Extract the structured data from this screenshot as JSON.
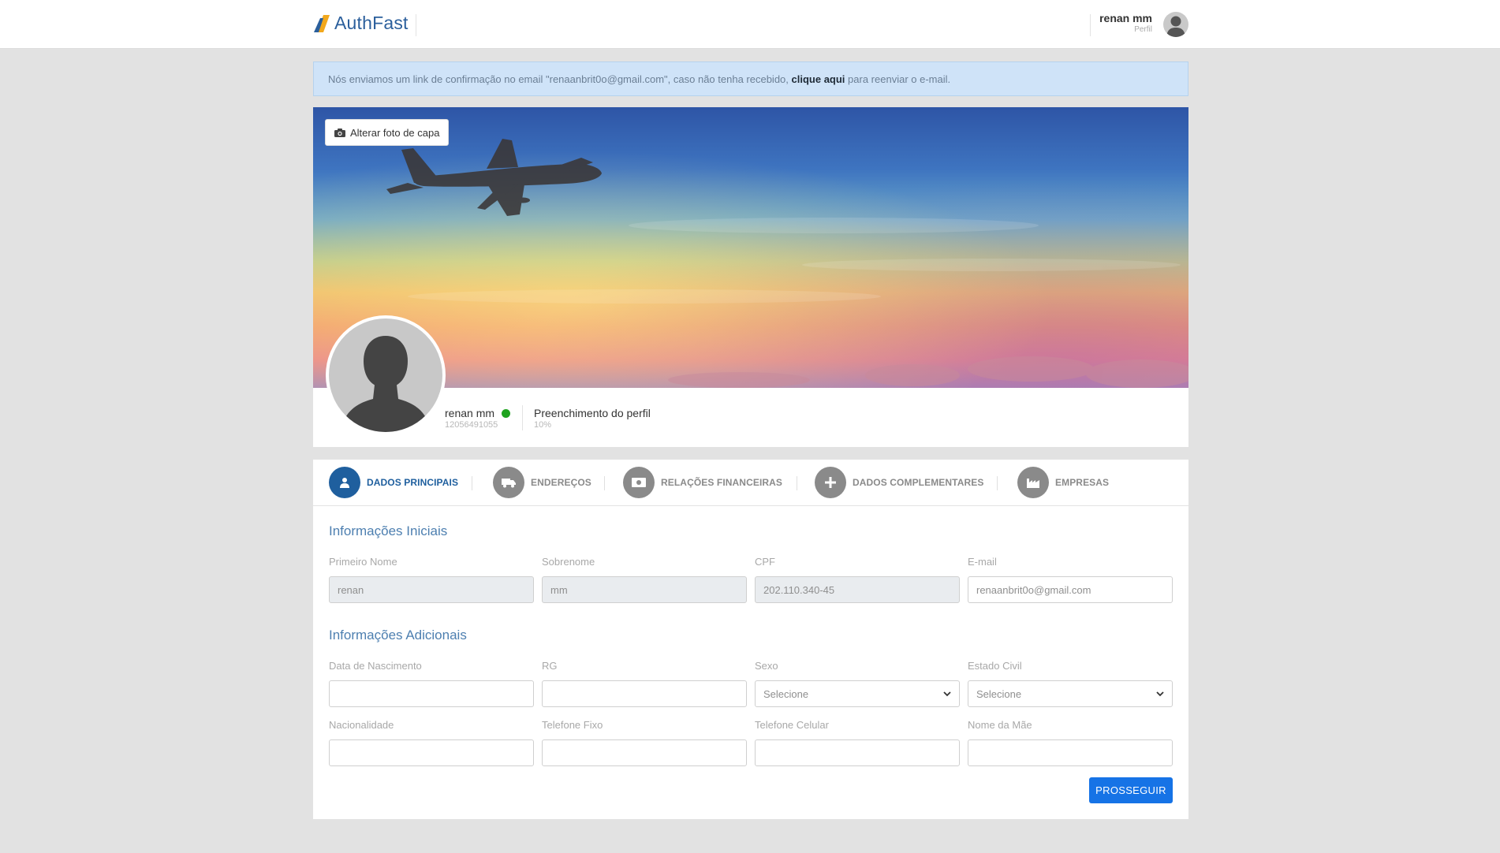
{
  "app": {
    "name": "AuthFast"
  },
  "header": {
    "user_name": "renan mm",
    "user_sub": "Perfil"
  },
  "alert": {
    "pre": "Nós enviamos um link de confirmação no email \"renaanbrit0o@gmail.com\", caso não tenha recebido,",
    "link": "clique aqui",
    "post": "para reenviar o e-mail."
  },
  "cover": {
    "change_label": "Alterar foto de capa"
  },
  "profile": {
    "name": "renan mm",
    "id": "12056491055",
    "fill_title": "Preenchimento do perfil",
    "fill_value": "10%",
    "status_color": "#1fa31f"
  },
  "tabs": [
    {
      "label": "DADOS PRINCIPAIS",
      "icon": "user-icon",
      "active": true
    },
    {
      "label": "ENDEREÇOS",
      "icon": "truck-icon",
      "active": false
    },
    {
      "label": "RELAÇÕES FINANCEIRAS",
      "icon": "money-icon",
      "active": false
    },
    {
      "label": "DADOS COMPLEMENTARES",
      "icon": "plus-icon",
      "active": false
    },
    {
      "label": "EMPRESAS",
      "icon": "factory-icon",
      "active": false
    }
  ],
  "sections": {
    "initial": "Informações Iniciais",
    "additional": "Informações Adicionais"
  },
  "fields": {
    "first_name": {
      "label": "Primeiro Nome",
      "value": "renan"
    },
    "last_name": {
      "label": "Sobrenome",
      "value": "mm"
    },
    "cpf": {
      "label": "CPF",
      "value": "202.110.340-45"
    },
    "email": {
      "label": "E-mail",
      "value": "renaanbrit0o@gmail.com"
    },
    "birth": {
      "label": "Data de Nascimento",
      "value": ""
    },
    "rg": {
      "label": "RG",
      "value": ""
    },
    "sex": {
      "label": "Sexo",
      "value": "Selecione"
    },
    "civil": {
      "label": "Estado Civil",
      "value": "Selecione"
    },
    "nationality": {
      "label": "Nacionalidade",
      "value": ""
    },
    "phone": {
      "label": "Telefone Fixo",
      "value": ""
    },
    "mobile": {
      "label": "Telefone Celular",
      "value": ""
    },
    "mother": {
      "label": "Nome da Mãe",
      "value": ""
    }
  },
  "actions": {
    "next": "PROSSEGUIR"
  },
  "colors": {
    "primary": "#1673e6",
    "accent": "#1f5f9e",
    "alert_bg": "#cfe3f8"
  }
}
